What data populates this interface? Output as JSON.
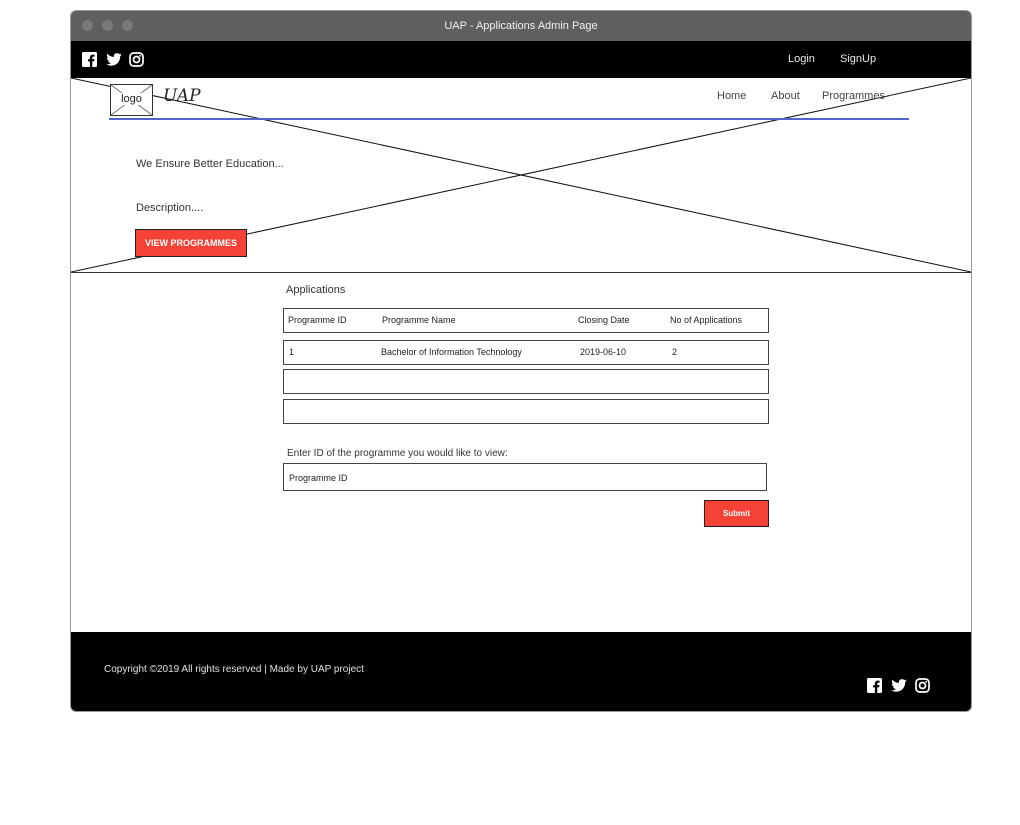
{
  "window": {
    "title": "UAP -  Applications  Admin Page"
  },
  "top_bar": {
    "social_icons": [
      "facebook-icon",
      "twitter-icon",
      "instagram-icon"
    ],
    "login_label": "Login",
    "signup_label": "SignUp"
  },
  "header": {
    "logo_label": "logo",
    "brand": "UAP",
    "nav": [
      "Home",
      "About",
      "Programmes"
    ]
  },
  "hero": {
    "tagline": "We Ensure Better Education...",
    "description": "Description....",
    "button_label": "VIEW PROGRAMMES"
  },
  "applications": {
    "title": "Applications",
    "columns": [
      "Programme ID",
      "Programme Name",
      "Closing Date",
      "No of Applications"
    ],
    "rows": [
      [
        "1",
        "Bachelor of Information Technology",
        "2019-06-10",
        "2"
      ]
    ]
  },
  "lookup": {
    "prompt": "Enter ID of the programme you would like to view:",
    "input_value": "Programme ID",
    "submit_label": "Submit"
  },
  "footer": {
    "copyright": "Copyright ©2019 All rights reserved | Made by UAP project",
    "social_icons": [
      "facebook-icon",
      "twitter-icon",
      "instagram-icon"
    ]
  },
  "colors": {
    "accent": "#f44336",
    "nav_underline": "#5066c8",
    "bar": "#000000"
  }
}
